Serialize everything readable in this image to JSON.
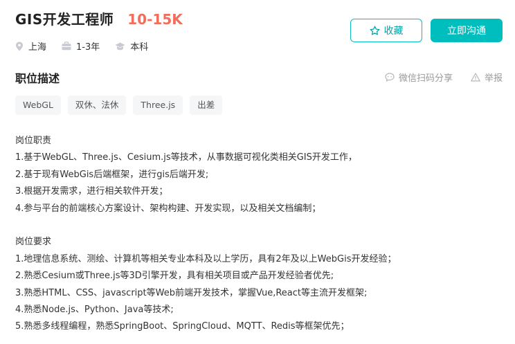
{
  "job": {
    "title": "GIS开发工程师",
    "salary": "10-15K",
    "location": "上海",
    "experience": "1-3年",
    "education": "本科"
  },
  "buttons": {
    "collect": "收藏",
    "chat": "立即沟通"
  },
  "section": {
    "title": "职位描述",
    "share": "微信扫码分享",
    "report": "举报"
  },
  "tags": [
    "WebGL",
    "双休、法休",
    "Three.js",
    "出差"
  ],
  "description": {
    "duties_title": "岗位职责",
    "duties": [
      "1.基于WebGL、Three.js、Cesium.js等技术，从事数据可视化类相关GIS开发工作，",
      "2.基于现有WebGis后端框架，进行gis后端开发;",
      "3.根据开发需求，进行相关软件开发；",
      "4.参与平台的前端核心方案设计、架构构建、开发实现，以及相关文档编制；"
    ],
    "requirements_title": "岗位要求",
    "requirements": [
      "1.地理信息系统、测绘、计算机等相关专业本科及以上学历，具有2年及以上WebGis开发经验；",
      "2.熟悉Cesium或Three.js等3D引擎开发，具有相关项目或产品开发经验者优先;",
      "3.熟悉HTML、CSS、javascript等Web前端开发技术，掌握Vue,React等主流开发框架;",
      "4.熟悉Node.js、Python、Java等技术;",
      "5.熟悉多线程编程，熟悉SpringBoot、SpringCloud、MQTT、Redis等框架优先；"
    ]
  },
  "colors": {
    "accent": "#00bebd",
    "salary": "#f26d5b"
  },
  "icons": {
    "location": "location-pin-icon",
    "experience": "briefcase-icon",
    "education": "graduation-cap-icon",
    "collect": "star-icon",
    "share": "chat-bubble-icon",
    "report": "warning-triangle-icon"
  }
}
